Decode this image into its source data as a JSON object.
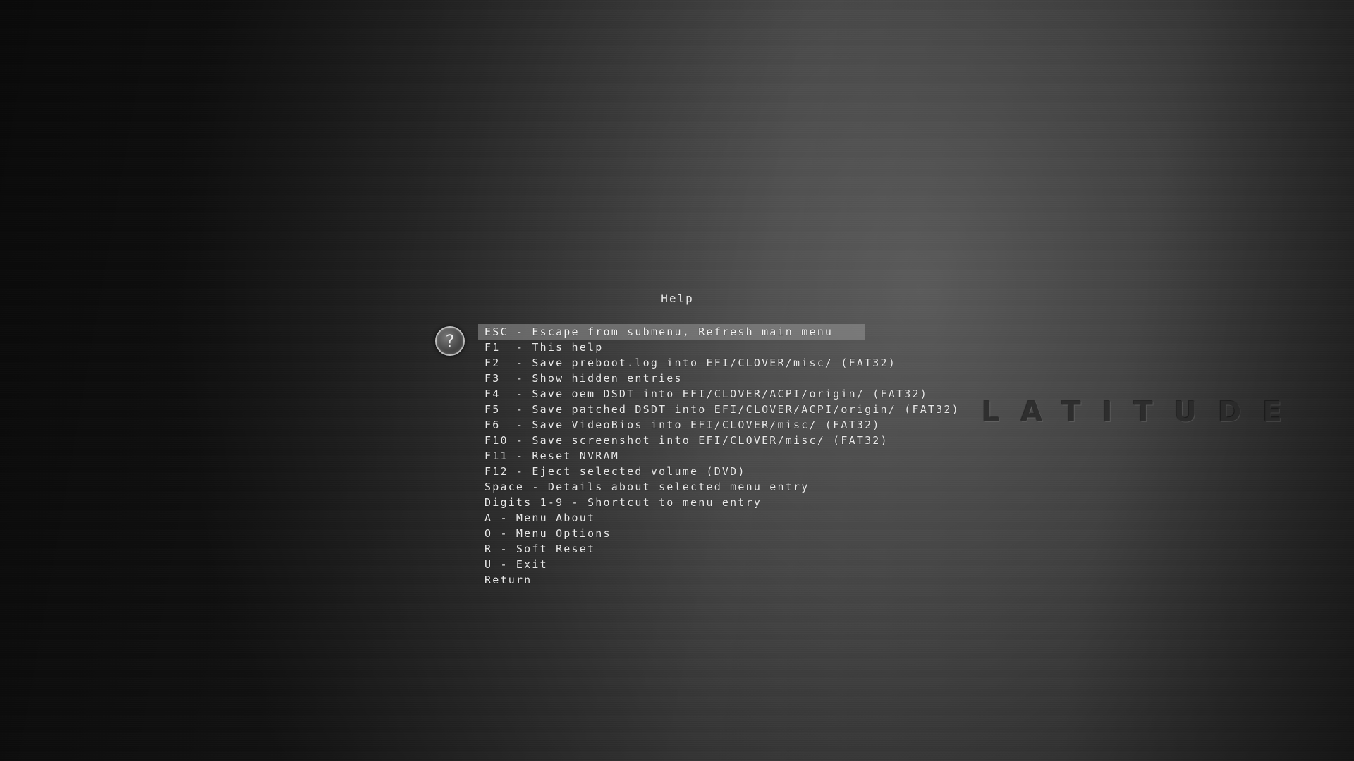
{
  "screen": {
    "title": "Help",
    "brand_text": "LATITUDE",
    "icon": "help-question-icon",
    "icon_glyph": "?"
  },
  "menu": {
    "selected_index": 0,
    "items": [
      {
        "label": "ESC - Escape from submenu, Refresh main menu"
      },
      {
        "label": "F1  - This help"
      },
      {
        "label": "F2  - Save preboot.log into EFI/CLOVER/misc/ (FAT32)"
      },
      {
        "label": "F3  - Show hidden entries"
      },
      {
        "label": "F4  - Save oem DSDT into EFI/CLOVER/ACPI/origin/ (FAT32)"
      },
      {
        "label": "F5  - Save patched DSDT into EFI/CLOVER/ACPI/origin/ (FAT32)"
      },
      {
        "label": "F6  - Save VideoBios into EFI/CLOVER/misc/ (FAT32)"
      },
      {
        "label": "F10 - Save screenshot into EFI/CLOVER/misc/ (FAT32)"
      },
      {
        "label": "F11 - Reset NVRAM"
      },
      {
        "label": "F12 - Eject selected volume (DVD)"
      },
      {
        "label": "Space - Details about selected menu entry"
      },
      {
        "label": "Digits 1-9 - Shortcut to menu entry"
      },
      {
        "label": "A - Menu About"
      },
      {
        "label": "O - Menu Options"
      },
      {
        "label": "R - Soft Reset"
      },
      {
        "label": "U - Exit"
      },
      {
        "label": "Return"
      }
    ]
  },
  "colors": {
    "text": "#e8e8e8",
    "selection": "#8a8a8a"
  }
}
